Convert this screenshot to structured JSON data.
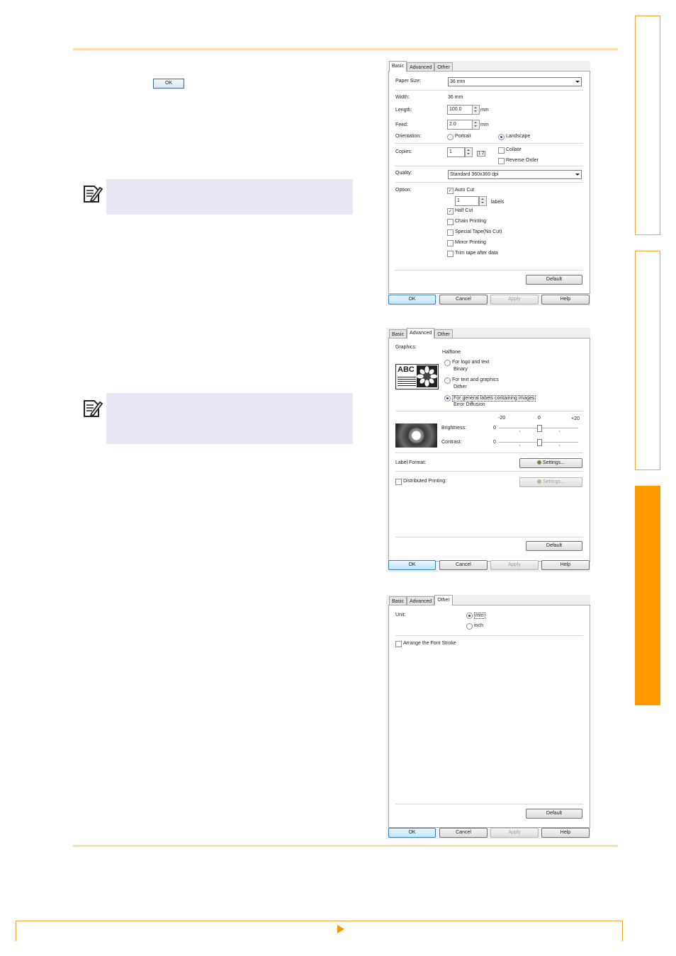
{
  "manual": {
    "ok_button_label": "OK"
  },
  "dialog_basic": {
    "tabs": [
      "Basic",
      "Advanced",
      "Other"
    ],
    "paper_size": {
      "label": "Paper Size:",
      "value": "36 mm"
    },
    "width": {
      "label": "Width:",
      "value": "36 mm"
    },
    "length": {
      "label": "Length:",
      "value": "100.0",
      "unit": "mm"
    },
    "feed": {
      "label": "Feed:",
      "value": "2.0",
      "unit": "mm"
    },
    "orientation": {
      "label": "Orientation:",
      "portrait": "Portrait",
      "landscape": "Landscape",
      "selected": "Landscape"
    },
    "copies": {
      "label": "Copies:",
      "value": "1",
      "collate": "Collate",
      "reverse_order": "Reverse Order",
      "collate_icon_text": "1 2"
    },
    "quality": {
      "label": "Quality:",
      "value": "Standard 360x360 dpi"
    },
    "option": {
      "label": "Option:",
      "auto_cut": "Auto Cut",
      "auto_cut_checked": true,
      "labels_count": "1",
      "labels_unit": "labels",
      "half_cut": "Half Cut",
      "half_cut_checked": true,
      "chain_printing": "Chain Printing",
      "special_tape": "Special Tape(No Cut)",
      "mirror_printing": "Mirror Printing",
      "trim_tape": "Trim tape after data"
    },
    "default_button": "Default",
    "buttons": {
      "ok": "OK",
      "cancel": "Cancel",
      "apply": "Apply",
      "help": "Help"
    }
  },
  "dialog_advanced": {
    "tabs": [
      "Basic",
      "Advanced",
      "Other"
    ],
    "graphics_label": "Graphics:",
    "halftone_label": "Halftone",
    "preview_text": "ABC",
    "options": [
      {
        "line1": "For logo and text",
        "line2": "Binary",
        "selected": false
      },
      {
        "line1": "For text and graphics",
        "line2": "Dither",
        "selected": false
      },
      {
        "line1": "For general labels containing images",
        "line2": "Error Diffusion",
        "selected": true
      }
    ],
    "scale": {
      "min": "-20",
      "mid": "0",
      "max": "+20"
    },
    "brightness": {
      "label": "Brightness:",
      "value": "0"
    },
    "contrast": {
      "label": "Contrast:",
      "value": "0"
    },
    "label_format": "Label Format:",
    "settings_button": "Settings...",
    "distributed_printing": "Distributed Printing:",
    "settings_button_2": "Settings...",
    "default_button": "Default",
    "buttons": {
      "ok": "OK",
      "cancel": "Cancel",
      "apply": "Apply",
      "help": "Help"
    }
  },
  "dialog_other": {
    "tabs": [
      "Basic",
      "Advanced",
      "Other"
    ],
    "unit_label": "Unit:",
    "unit_mm": "mm",
    "unit_inch": "inch",
    "unit_selected": "mm",
    "arrange_font_stroke": "Arrange the Font Stroke",
    "default_button": "Default",
    "buttons": {
      "ok": "OK",
      "cancel": "Cancel",
      "apply": "Apply",
      "help": "Help"
    }
  },
  "colors": {
    "accent_orange": "#ff9900",
    "rule_orange": "#fddcaa",
    "note_bg": "#e7e8f3"
  }
}
